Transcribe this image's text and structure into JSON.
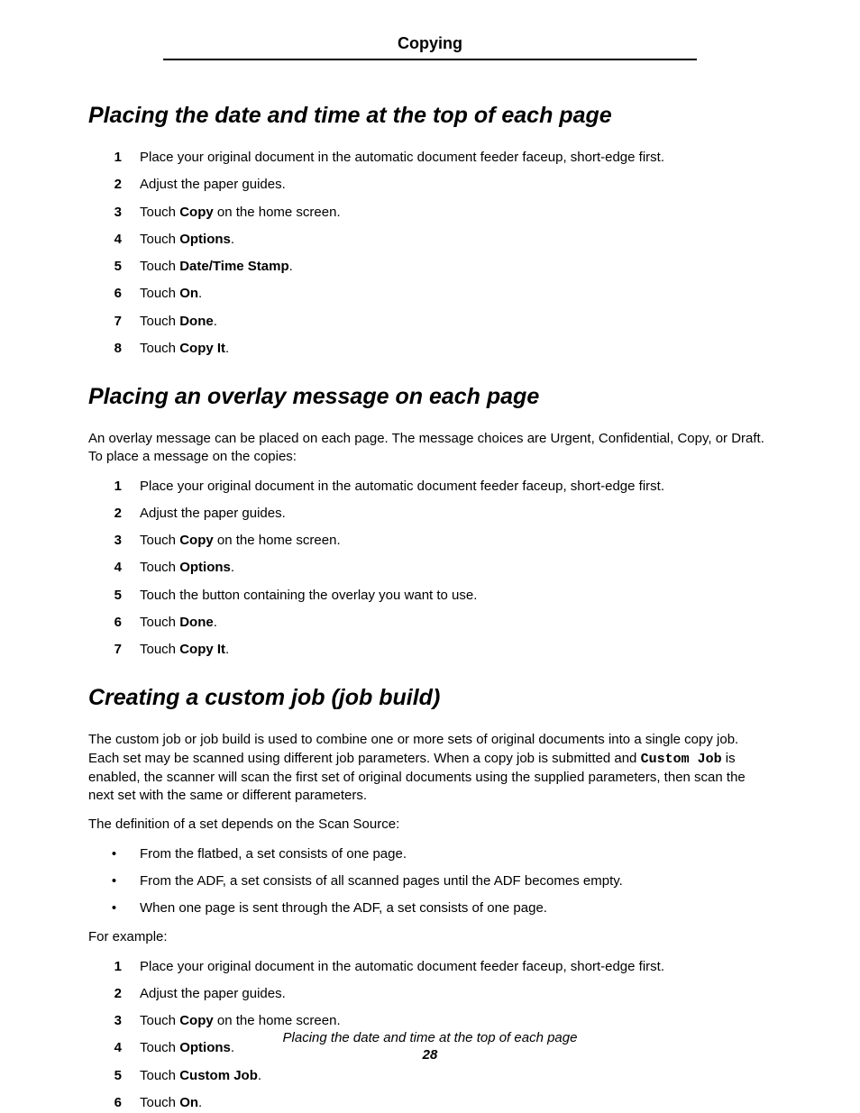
{
  "header": {
    "chapter": "Copying"
  },
  "section1": {
    "heading": "Placing the date and time at the top of each page",
    "steps": [
      {
        "n": "1",
        "pre": "Place your original document in the automatic document feeder faceup, short-edge first."
      },
      {
        "n": "2",
        "pre": "Adjust the paper guides."
      },
      {
        "n": "3",
        "pre": "Touch ",
        "bold": "Copy",
        "post": " on the home screen."
      },
      {
        "n": "4",
        "pre": "Touch ",
        "bold": "Options",
        "post": "."
      },
      {
        "n": "5",
        "pre": "Touch ",
        "bold": "Date/Time Stamp",
        "post": "."
      },
      {
        "n": "6",
        "pre": "Touch ",
        "bold": "On",
        "post": "."
      },
      {
        "n": "7",
        "pre": "Touch ",
        "bold": "Done",
        "post": "."
      },
      {
        "n": "8",
        "pre": "Touch ",
        "bold": "Copy It",
        "post": "."
      }
    ]
  },
  "section2": {
    "heading": "Placing an overlay message on each page",
    "intro": "An overlay message can be placed on each page. The message choices are Urgent, Confidential, Copy, or Draft. To place a message on the copies:",
    "steps": [
      {
        "n": "1",
        "pre": "Place your original document in the automatic document feeder faceup, short-edge first."
      },
      {
        "n": "2",
        "pre": "Adjust the paper guides."
      },
      {
        "n": "3",
        "pre": "Touch ",
        "bold": "Copy",
        "post": " on the home screen."
      },
      {
        "n": "4",
        "pre": "Touch ",
        "bold": "Options",
        "post": "."
      },
      {
        "n": "5",
        "pre": "Touch the button containing the overlay you want to use."
      },
      {
        "n": "6",
        "pre": "Touch ",
        "bold": "Done",
        "post": "."
      },
      {
        "n": "7",
        "pre": "Touch ",
        "bold": "Copy It",
        "post": "."
      }
    ]
  },
  "section3": {
    "heading": "Creating a custom job (job build)",
    "intro_pre": "The custom job or job build is used to combine one or more sets of original documents into a single copy job. Each set may be scanned using different job parameters. When a copy job is submitted and ",
    "intro_mono": "Custom Job",
    "intro_post": " is enabled, the scanner will scan the first set of original documents using the supplied parameters, then scan the next set with the same or different parameters.",
    "def_line": "The definition of a set depends on the Scan Source:",
    "bullets": [
      "From the flatbed, a set consists of one page.",
      "From the ADF, a set consists of all scanned pages until the ADF becomes empty.",
      "When one page is sent through the ADF, a set consists of one page."
    ],
    "example_label": "For example:",
    "steps": [
      {
        "n": "1",
        "pre": "Place your original document in the automatic document feeder faceup, short-edge first."
      },
      {
        "n": "2",
        "pre": "Adjust the paper guides."
      },
      {
        "n": "3",
        "pre": "Touch ",
        "bold": "Copy",
        "post": " on the home screen."
      },
      {
        "n": "4",
        "pre": "Touch ",
        "bold": "Options",
        "post": "."
      },
      {
        "n": "5",
        "pre": "Touch ",
        "bold": "Custom Job",
        "post": "."
      },
      {
        "n": "6",
        "pre": "Touch ",
        "bold": "On",
        "post": "."
      }
    ]
  },
  "footer": {
    "title": "Placing the date and time at the top of each page",
    "page": "28"
  }
}
